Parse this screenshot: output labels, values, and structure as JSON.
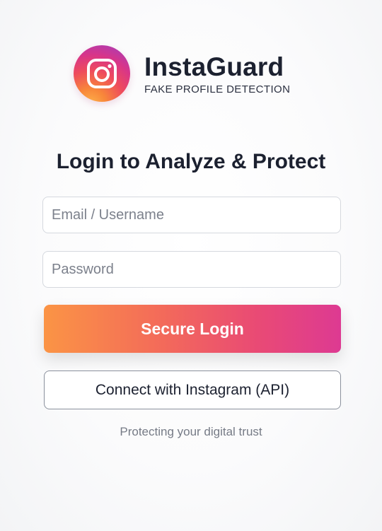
{
  "brand": {
    "name": "InstaGuard",
    "tagline": "FAKE PROFILE DETECTION",
    "logo_icon": "camera-icon"
  },
  "login": {
    "heading": "Login to Analyze & Protect",
    "email_placeholder": "Email / Username",
    "email_value": "",
    "password_placeholder": "Password",
    "password_value": "",
    "submit_label": "Secure Login",
    "connect_label": "Connect with Instagram (API)",
    "footer": "Protecting your digital trust"
  },
  "colors": {
    "primary_gradient_start": "#fb9445",
    "primary_gradient_end": "#dd3a92",
    "text_dark": "#1c2130",
    "muted": "#767b86"
  }
}
